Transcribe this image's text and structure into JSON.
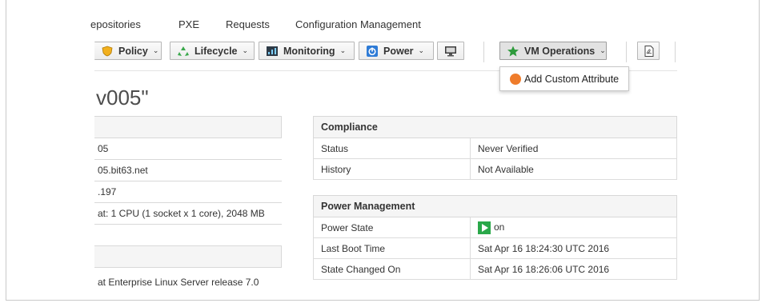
{
  "nav": {
    "items": [
      "epositories",
      "PXE",
      "Requests",
      "Configuration Management"
    ]
  },
  "toolbar": {
    "policy_label": "Policy",
    "lifecycle_label": "Lifecycle",
    "monitoring_label": "Monitoring",
    "power_label": "Power",
    "vm_ops_label": "VM Operations"
  },
  "dropdown": {
    "item_label": "Add Custom Attribute"
  },
  "page": {
    "title": "v005\""
  },
  "properties": {
    "rows": [
      "05",
      "05.bit63.net",
      ".197",
      "at: 1 CPU (1 socket x 1 core), 2048 MB",
      "",
      "",
      "at Enterprise Linux Server release 7.0"
    ]
  },
  "compliance": {
    "header": "Compliance",
    "rows": [
      {
        "label": "Status",
        "value": "Never Verified"
      },
      {
        "label": "History",
        "value": "Not Available"
      }
    ]
  },
  "power": {
    "header": "Power Management",
    "rows": [
      {
        "label": "Power State",
        "value": "on"
      },
      {
        "label": "Last Boot Time",
        "value": "Sat Apr 16 18:24:30 UTC 2016"
      },
      {
        "label": "State Changed On",
        "value": "Sat Apr 16 18:26:06 UTC 2016"
      }
    ]
  },
  "colors": {
    "power_on": "#2aa84a",
    "custom_attr_dot": "#ef7c2b",
    "vm_ops_star": "#2e9b3c"
  }
}
